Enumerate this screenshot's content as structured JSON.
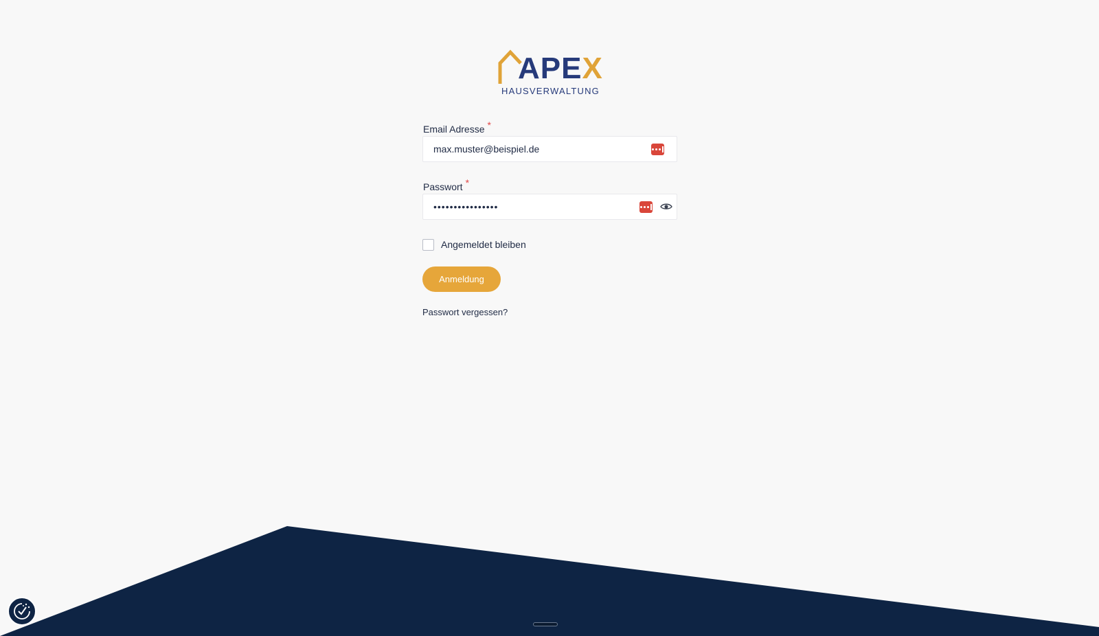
{
  "logo": {
    "word_main": "APE",
    "word_accent": "X",
    "subtitle": "HAUSVERWALTUNG",
    "brand_color": "#263a7a",
    "accent_color": "#e0a338"
  },
  "form": {
    "email": {
      "label": "Email Adresse",
      "required_marker": "*",
      "value": "max.muster@beispiel.de"
    },
    "password": {
      "label": "Passwort",
      "required_marker": "*",
      "value": "••••••••••••••••"
    },
    "remember_label": "Angemeldet bleiben",
    "submit_label": "Anmeldung",
    "forgot_label": "Passwort vergessen?"
  },
  "colors": {
    "background": "#f8f8f8",
    "footer": "#0e2444",
    "button": "#e6a63a",
    "required": "#e04848"
  }
}
